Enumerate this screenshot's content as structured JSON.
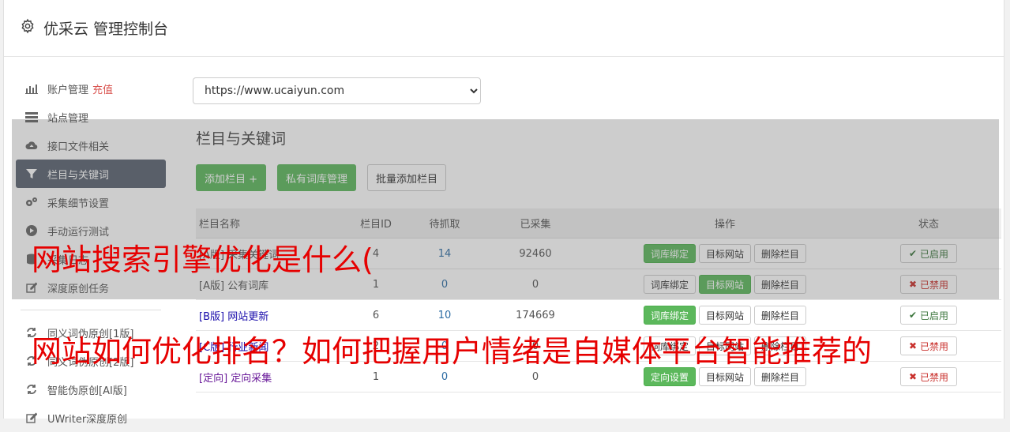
{
  "header": {
    "title": "优采云 管理控制台",
    "icon": "gear-icon"
  },
  "sidebar": {
    "items": [
      {
        "label": "账户管理",
        "extra": "充值",
        "icon": "bar-chart-icon"
      },
      {
        "label": "站点管理",
        "icon": "server-icon"
      },
      {
        "label": "接口文件相关",
        "icon": "cloud-upload-icon"
      },
      {
        "label": "栏目与关键词",
        "icon": "filter-icon",
        "active": true
      },
      {
        "label": "采集细节设置",
        "icon": "cogs-icon"
      },
      {
        "label": "手动运行测试",
        "icon": "play-icon"
      },
      {
        "label": "采集日志",
        "icon": "database-icon"
      },
      {
        "label": "深度原创任务",
        "icon": "edit-icon"
      }
    ],
    "items2": [
      {
        "label": "同义词伪原创[1版]",
        "icon": "refresh-icon"
      },
      {
        "label": "同义词伪原创[2版]",
        "icon": "refresh-icon"
      },
      {
        "label": "智能伪原创[AI版]",
        "icon": "refresh-icon"
      },
      {
        "label": "UWriter深度原创",
        "icon": "edit-icon"
      }
    ]
  },
  "main": {
    "site_select": "https://www.ucaiyun.com",
    "section_title": "栏目与关键词",
    "buttons": {
      "add": "添加栏目 +",
      "private": "私有词库管理",
      "batch": "批量添加栏目"
    },
    "table": {
      "headers": {
        "name": "栏目名称",
        "id": "栏目ID",
        "pending": "待抓取",
        "collected": "已采集",
        "ops": "操作",
        "status": "状态"
      },
      "rows": [
        {
          "name": "[A版] 采集关键词",
          "id": "4",
          "pending": "14",
          "collected": "92460",
          "op1": "词库绑定",
          "op2": "目标网站",
          "op3": "删除栏目",
          "status": "已启用",
          "enabled": true
        },
        {
          "name": "[A版] 公有词库",
          "id": "1",
          "pending": "0",
          "collected": "0",
          "op1": "词库绑定",
          "op2": "目标网站",
          "op3": "删除栏目",
          "status": "已禁用",
          "enabled": false
        },
        {
          "name": "[B版] 网站更新",
          "id": "6",
          "pending": "10",
          "collected": "174669",
          "op1": "词库绑定",
          "op2": "目标网站",
          "op3": "删除栏目",
          "status": "已启用",
          "enabled": true
        },
        {
          "name": "[C版] 行业新闻",
          "id": "2",
          "pending": "0",
          "collected": "0",
          "op1": "词库绑定",
          "op2": "目标网站",
          "op3": "删除栏目",
          "status": "已禁用",
          "enabled": false
        },
        {
          "name": "[定向] 定向采集",
          "id": "1",
          "pending": "0",
          "collected": "0",
          "op1": "定向设置",
          "op2": "目标网站",
          "op3": "删除栏目",
          "status": "已禁用",
          "enabled": false
        }
      ]
    }
  },
  "watermark": {
    "line1": "网站搜索引擎优化是什么(",
    "line2": "网站如何优化排名？如何把握用户情绪是自媒体平台智能推荐的"
  },
  "colors": {
    "accent_green": "#5cb85c",
    "active_sidebar": "#5a6270",
    "watermark_red": "#e60000",
    "link_blue": "#2e6da4"
  }
}
